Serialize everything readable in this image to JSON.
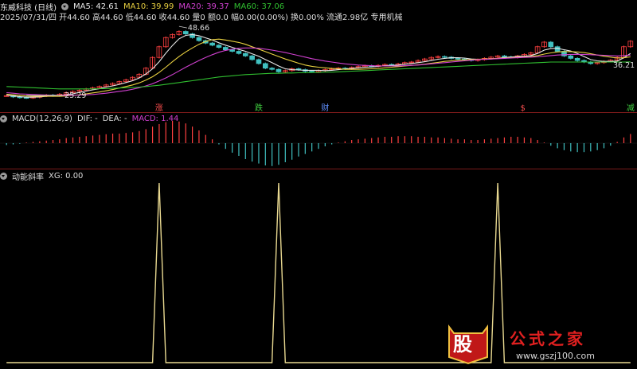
{
  "header": {
    "title": "东威科技 (日线)",
    "ma5": "MA5: 42.61",
    "ma10": "MA10: 39.99",
    "ma20": "MA20: 39.37",
    "ma60": "MA60: 37.06",
    "info": "2025/07/31/四 开44.60 高44.60 低44.60 收44.60 量0 额0.0 幅0.00(0.00%) 换0.00% 流通2.98亿 专用机械"
  },
  "colors": {
    "ma5": "#e8e8e8",
    "ma10": "#e8d040",
    "ma20": "#d040d0",
    "ma60": "#30c030",
    "up": "#ff4040",
    "down": "#40c0c0",
    "xg": "#e8d890",
    "sep": "#7a1a1a"
  },
  "price_annotations": {
    "high": "48.66",
    "low": "25.29",
    "right": "36.21"
  },
  "event_marks": [
    {
      "label": "涨",
      "color": "#ff5050"
    },
    {
      "label": "跌",
      "color": "#40d040"
    },
    {
      "label": "财",
      "color": "#6090ff"
    },
    {
      "label": "$",
      "color": "#ff5050"
    },
    {
      "label": "减",
      "color": "#40d040"
    }
  ],
  "macd_panel": {
    "title": "MACD(12,26,9)",
    "dif": "DIF: -",
    "dea": "DEA: -",
    "macd": "MACD: 1.44"
  },
  "xg_panel": {
    "title": "动能斜率",
    "xg": "XG: 0.00"
  },
  "watermark": {
    "logo": "股",
    "name": "公式之家",
    "url": "www.gszj100.com"
  },
  "chart_data": [
    {
      "type": "candlestick",
      "title": "东威科技 (日线)",
      "ylim": [
        24,
        50
      ],
      "close": [
        26.0,
        25.6,
        25.4,
        25.3,
        25.5,
        25.9,
        26.2,
        26.0,
        26.5,
        27.0,
        27.4,
        27.8,
        28.2,
        28.6,
        29.0,
        29.5,
        30.0,
        30.6,
        31.2,
        32.0,
        33.0,
        35.0,
        38.5,
        42.0,
        45.0,
        46.0,
        47.0,
        46.2,
        45.0,
        44.0,
        43.2,
        42.5,
        41.8,
        41.0,
        40.5,
        39.8,
        39.0,
        37.8,
        36.5,
        35.0,
        34.6,
        33.8,
        34.2,
        34.8,
        34.5,
        34.0,
        33.8,
        34.2,
        34.5,
        34.8,
        35.0,
        34.8,
        35.2,
        35.5,
        35.8,
        35.6,
        35.9,
        36.2,
        36.0,
        36.4,
        36.8,
        37.0,
        37.5,
        38.0,
        38.5,
        38.8,
        38.6,
        38.2,
        38.0,
        37.8,
        37.5,
        37.8,
        38.2,
        38.6,
        39.0,
        38.7,
        38.5,
        39.0,
        39.5,
        40.0,
        42.0,
        43.5,
        42.0,
        40.5,
        39.0,
        38.2,
        37.5,
        37.0,
        36.5,
        36.8,
        37.2,
        37.6,
        38.5,
        42.0,
        43.8
      ],
      "series": [
        {
          "name": "MA5",
          "values": [
            26.2,
            25.9,
            25.7,
            25.5,
            25.5,
            25.6,
            25.8,
            25.9,
            26.1,
            26.3,
            26.6,
            27.1,
            27.5,
            27.9,
            28.3,
            28.8,
            29.2,
            29.7,
            30.3,
            30.9,
            31.8,
            33.1,
            34.8,
            37.1,
            39.9,
            42.4,
            44.6,
            45.7,
            46.0,
            45.6,
            44.9,
            44.2,
            43.3,
            42.5,
            41.8,
            41.1,
            40.5,
            39.7,
            38.9,
            37.8,
            36.8,
            35.7,
            34.8,
            34.5,
            34.4,
            34.3,
            34.3,
            34.3,
            34.2,
            34.3,
            34.5,
            34.7,
            34.9,
            35.1,
            35.3,
            35.4,
            35.6,
            35.8,
            35.9,
            36.0,
            36.3,
            36.5,
            36.8,
            37.1,
            37.5,
            37.9,
            38.2,
            38.4,
            38.4,
            38.3,
            38.0,
            37.9,
            37.9,
            38.0,
            38.2,
            38.5,
            38.6,
            38.8,
            38.9,
            39.1,
            39.8,
            40.9,
            41.4,
            41.5,
            41.0,
            40.6,
            39.8,
            38.8,
            37.8,
            37.4,
            37.2,
            37.2,
            37.3,
            38.4,
            39.8
          ]
        },
        {
          "name": "MA10",
          "values": [
            26.5,
            26.3,
            26.1,
            25.9,
            25.8,
            25.8,
            25.8,
            25.8,
            25.8,
            25.9,
            26.1,
            26.3,
            26.6,
            26.9,
            27.2,
            27.6,
            28.0,
            28.5,
            29.0,
            29.5,
            30.2,
            31.1,
            32.2,
            33.6,
            35.3,
            37.1,
            38.8,
            40.3,
            41.6,
            42.8,
            43.7,
            44.3,
            44.5,
            44.2,
            43.8,
            43.4,
            42.8,
            42.0,
            41.2,
            40.4,
            39.6,
            38.8,
            38.0,
            37.3,
            36.6,
            36.0,
            35.6,
            35.3,
            35.1,
            34.9,
            34.8,
            34.6,
            34.6,
            34.6,
            34.7,
            34.8,
            34.9,
            35.1,
            35.3,
            35.5,
            35.7,
            35.9,
            36.1,
            36.3,
            36.6,
            36.9,
            37.2,
            37.4,
            37.6,
            37.7,
            37.8,
            37.9,
            38.0,
            38.1,
            38.2,
            38.3,
            38.4,
            38.5,
            38.6,
            38.8,
            39.1,
            39.6,
            40.0,
            40.3,
            40.4,
            40.4,
            40.3,
            40.1,
            39.7,
            39.3,
            38.9,
            38.6,
            38.3,
            38.4,
            38.7
          ]
        },
        {
          "name": "MA20",
          "values": [
            27.0,
            26.8,
            26.6,
            26.5,
            26.4,
            26.3,
            26.2,
            26.1,
            26.1,
            26.1,
            26.1,
            26.2,
            26.3,
            26.4,
            26.6,
            26.8,
            27.1,
            27.4,
            27.7,
            28.1,
            28.6,
            29.2,
            29.9,
            30.8,
            31.8,
            32.9,
            34.1,
            35.3,
            36.4,
            37.5,
            38.5,
            39.4,
            40.2,
            40.8,
            41.2,
            41.5,
            41.6,
            41.6,
            41.5,
            41.2,
            40.9,
            40.5,
            40.1,
            39.6,
            39.1,
            38.6,
            38.1,
            37.7,
            37.3,
            37.0,
            36.7,
            36.4,
            36.2,
            36.0,
            35.9,
            35.8,
            35.7,
            35.7,
            35.7,
            35.7,
            35.8,
            35.9,
            36.0,
            36.2,
            36.4,
            36.6,
            36.8,
            37.0,
            37.2,
            37.4,
            37.6,
            37.8,
            37.9,
            38.0,
            38.1,
            38.2,
            38.3,
            38.4,
            38.5,
            38.6,
            38.7,
            38.9,
            39.1,
            39.3,
            39.4,
            39.5,
            39.5,
            39.5,
            39.4,
            39.3,
            39.2,
            39.1,
            39.0,
            39.1,
            39.3
          ]
        },
        {
          "name": "MA60",
          "values": [
            29.0,
            28.9,
            28.8,
            28.7,
            28.6,
            28.5,
            28.4,
            28.3,
            28.2,
            28.2,
            28.2,
            28.2,
            28.2,
            28.2,
            28.3,
            28.3,
            28.4,
            28.5,
            28.6,
            28.7,
            28.8,
            29.0,
            29.2,
            29.4,
            29.7,
            30.0,
            30.3,
            30.6,
            30.9,
            31.2,
            31.5,
            31.8,
            32.1,
            32.3,
            32.5,
            32.7,
            32.9,
            33.0,
            33.1,
            33.2,
            33.3,
            33.3,
            33.4,
            33.4,
            33.5,
            33.5,
            33.6,
            33.6,
            33.7,
            33.7,
            33.8,
            33.9,
            34.0,
            34.1,
            34.2,
            34.3,
            34.4,
            34.5,
            34.6,
            34.7,
            34.8,
            34.9,
            35.0,
            35.1,
            35.2,
            35.3,
            35.4,
            35.5,
            35.6,
            35.7,
            35.8,
            35.9,
            36.0,
            36.1,
            36.2,
            36.3,
            36.4,
            36.5,
            36.6,
            36.7,
            36.8,
            36.9,
            37.0,
            37.0,
            37.0,
            37.0,
            37.0,
            37.0,
            37.0,
            37.0,
            37.0,
            37.0,
            37.0,
            37.0,
            37.06
          ]
        }
      ]
    },
    {
      "type": "bar",
      "title": "MACD(12,26,9)",
      "values": [
        -0.3,
        -0.2,
        -0.1,
        0.1,
        0.2,
        0.3,
        0.4,
        0.5,
        0.6,
        0.8,
        0.9,
        1.0,
        1.1,
        1.2,
        1.3,
        1.4,
        1.5,
        1.5,
        1.6,
        1.7,
        1.9,
        2.2,
        2.6,
        3.0,
        3.3,
        3.5,
        3.4,
        3.1,
        2.6,
        2.0,
        1.3,
        0.6,
        -0.2,
        -0.9,
        -1.5,
        -2.0,
        -2.5,
        -2.9,
        -3.2,
        -3.5,
        -3.6,
        -3.4,
        -3.0,
        -2.6,
        -2.1,
        -1.7,
        -1.3,
        -0.9,
        -0.5,
        -0.2,
        0.1,
        0.3,
        0.5,
        0.6,
        0.7,
        0.8,
        0.9,
        1.0,
        1.0,
        1.1,
        1.1,
        1.1,
        1.0,
        1.0,
        0.9,
        0.9,
        0.8,
        0.7,
        0.6,
        0.6,
        0.5,
        0.5,
        0.6,
        0.7,
        0.8,
        0.9,
        1.0,
        1.0,
        0.9,
        0.8,
        0.5,
        0.1,
        -0.4,
        -0.8,
        -1.1,
        -1.3,
        -1.4,
        -1.4,
        -1.3,
        -1.1,
        -0.8,
        -0.4,
        0.2,
        0.9,
        1.44
      ]
    },
    {
      "type": "line",
      "title": "动能斜率",
      "values": [
        0,
        0,
        0,
        0,
        0,
        0,
        0,
        0,
        0,
        0,
        0,
        0,
        0,
        0,
        0,
        0,
        0,
        0,
        0,
        0,
        0,
        0,
        0,
        1,
        0,
        0,
        0,
        0,
        0,
        0,
        0,
        0,
        0,
        0,
        0,
        0,
        0,
        0,
        0,
        0,
        0,
        1,
        0,
        0,
        0,
        0,
        0,
        0,
        0,
        0,
        0,
        0,
        0,
        0,
        0,
        0,
        0,
        0,
        0,
        0,
        0,
        0,
        0,
        0,
        0,
        0,
        0,
        0,
        0,
        0,
        0,
        0,
        0,
        0,
        1,
        0,
        0,
        0,
        0,
        0,
        0,
        0,
        0,
        0,
        0,
        0,
        0,
        0,
        0,
        0,
        0,
        0,
        0,
        0,
        0
      ],
      "ylim": [
        0,
        1
      ]
    }
  ]
}
